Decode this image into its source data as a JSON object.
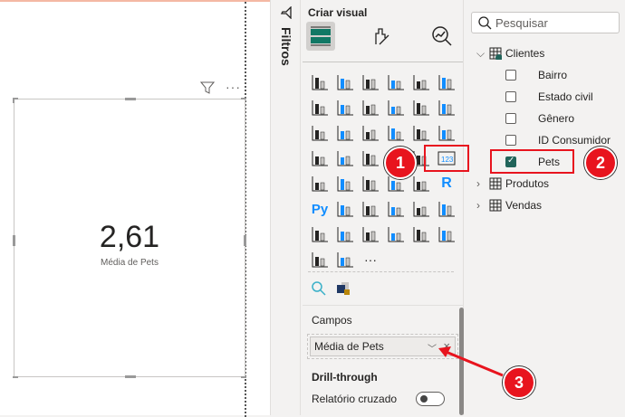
{
  "card": {
    "value": "2,61",
    "label": "Média de Pets"
  },
  "filters_pane": {
    "label": "Filtros"
  },
  "viz_pane": {
    "title": "Criar visual",
    "icons": [
      "stacked-bar-icon",
      "stacked-column-icon",
      "clustered-bar-icon",
      "clustered-column-icon",
      "100-bar-icon",
      "100-column-icon",
      "line-chart-icon",
      "area-chart-icon",
      "stacked-area-icon",
      "ribbon-area-icon",
      "line-column-icon",
      "line-clustered-column-icon",
      "ribbon-chart-icon",
      "waterfall-icon",
      "funnel-icon",
      "scatter-icon",
      "pie-icon",
      "donut-icon",
      "treemap-icon",
      "map-icon",
      "filled-map-icon",
      "azure-map-icon",
      "gauge-icon",
      "card-icon",
      "multirow-card-icon",
      "kpi-icon",
      "slicer-icon",
      "table-icon",
      "matrix-icon",
      "r-visual-icon",
      "python-visual-icon",
      "key-influencers-icon",
      "decomposition-tree-icon",
      "qa-icon",
      "narrative-icon",
      "goals-icon",
      "paginated-report-icon",
      "power-card-icon",
      "power-slicer-icon",
      "power-text-icon",
      "power-list-icon",
      "power-automate-icon",
      "power-apps-icon",
      "arrow-visual-icon",
      "more-icon"
    ],
    "campos_label": "Campos",
    "field": "Média de Pets",
    "drill_label": "Drill-through",
    "cross_report_label": "Relatório cruzado",
    "cross_report_on": false
  },
  "fields_pane": {
    "search_placeholder": "Pesquisar",
    "tables": [
      {
        "name": "Clientes",
        "expanded": true,
        "fields": [
          {
            "name": "Bairro",
            "checked": false
          },
          {
            "name": "Estado civil",
            "checked": false
          },
          {
            "name": "Gênero",
            "checked": false
          },
          {
            "name": "ID Consumidor",
            "checked": false
          },
          {
            "name": "Pets",
            "checked": true
          }
        ]
      },
      {
        "name": "Produtos",
        "expanded": false
      },
      {
        "name": "Vendas",
        "expanded": false
      }
    ]
  },
  "annotations": [
    "1",
    "2",
    "3"
  ],
  "colors": {
    "accent": "#21645a",
    "annotation": "#e8141e",
    "blue": "#118dff"
  }
}
